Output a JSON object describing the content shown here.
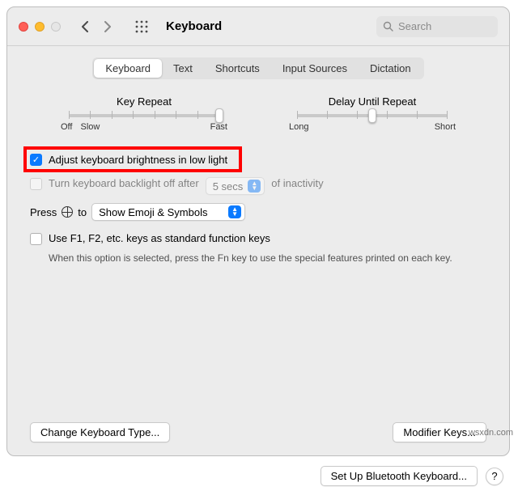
{
  "window": {
    "title": "Keyboard"
  },
  "search": {
    "placeholder": "Search"
  },
  "tabs": {
    "items": [
      "Keyboard",
      "Text",
      "Shortcuts",
      "Input Sources",
      "Dictation"
    ],
    "active": 0
  },
  "sliders": {
    "keyRepeat": {
      "label": "Key Repeat",
      "leftCap1": "Off",
      "leftCap2": "Slow",
      "rightCap": "Fast",
      "position": 100
    },
    "delay": {
      "label": "Delay Until Repeat",
      "leftCap": "Long",
      "rightCap": "Short",
      "position": 50
    }
  },
  "options": {
    "adjustBrightness": {
      "label": "Adjust keyboard brightness in low light",
      "checked": true
    },
    "backlightOff": {
      "prefix": "Turn keyboard backlight off after",
      "value": "5 secs",
      "suffix": "of inactivity",
      "checked": false
    },
    "pressGlobe": {
      "prefix": "Press",
      "mid": "to",
      "value": "Show Emoji & Symbols"
    },
    "fnKeys": {
      "label": "Use F1, F2, etc. keys as standard function keys",
      "description": "When this option is selected, press the Fn key to use the special features printed on each key.",
      "checked": false
    }
  },
  "buttons": {
    "changeType": "Change Keyboard Type...",
    "modifier": "Modifier Keys...",
    "bluetooth": "Set Up Bluetooth Keyboard...",
    "help": "?"
  },
  "watermark": "wsxdn.com"
}
